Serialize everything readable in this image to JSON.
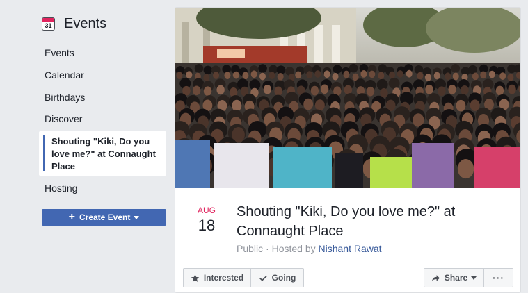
{
  "sidebar": {
    "icon_day": "31",
    "title": "Events",
    "items": [
      {
        "label": "Events"
      },
      {
        "label": "Calendar"
      },
      {
        "label": "Birthdays"
      },
      {
        "label": "Discover"
      }
    ],
    "active_item": "Shouting \"Kiki, Do you love me?\" at Connaught Place",
    "hosting_label": "Hosting",
    "create_label": "Create Event"
  },
  "event": {
    "month": "AUG",
    "day": "18",
    "title": "Shouting \"Kiki, Do you love me?\" at Connaught Place",
    "privacy": "Public",
    "hosted_by_prefix": " · Hosted by ",
    "host": "Nishant Rawat"
  },
  "actions": {
    "interested_label": "Interested",
    "going_label": "Going",
    "share_label": "Share",
    "more_label": "···"
  },
  "colors": {
    "accent": "#4267b2",
    "date_month": "#e0245e",
    "link": "#365899"
  },
  "icons": [
    "calendar-icon",
    "plus-icon",
    "chevron-down-icon",
    "star-icon",
    "check-icon",
    "share-arrow-icon",
    "more-icon"
  ]
}
